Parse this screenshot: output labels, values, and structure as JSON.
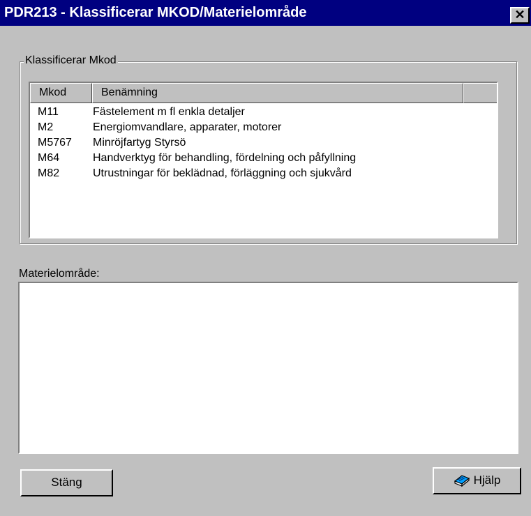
{
  "window": {
    "title": "PDR213 - Klassificerar MKOD/Materielområde",
    "close_glyph": "✕"
  },
  "group": {
    "legend": "Klassificerar Mkod",
    "columns": [
      "Mkod",
      "Benämning",
      ""
    ],
    "rows": [
      {
        "mkod": "M11",
        "benamning": "Fästelement m fl enkla detaljer"
      },
      {
        "mkod": "M2",
        "benamning": "Energiomvandlare, apparater, motorer"
      },
      {
        "mkod": "M5767",
        "benamning": "Minröjfartyg Styrsö"
      },
      {
        "mkod": "M64",
        "benamning": "Handverktyg för behandling, fördelning och påfyllning"
      },
      {
        "mkod": "M82",
        "benamning": "Utrustningar för beklädnad, förläggning och sjukvård"
      }
    ]
  },
  "materiel": {
    "label": "Materielområde:",
    "value": ""
  },
  "buttons": {
    "close_label": "Stäng",
    "help_label": "Hjälp",
    "help_icon": "help-book-icon"
  },
  "colors": {
    "titlebar": "#000080",
    "face": "#c0c0c0",
    "field": "#ffffff"
  }
}
